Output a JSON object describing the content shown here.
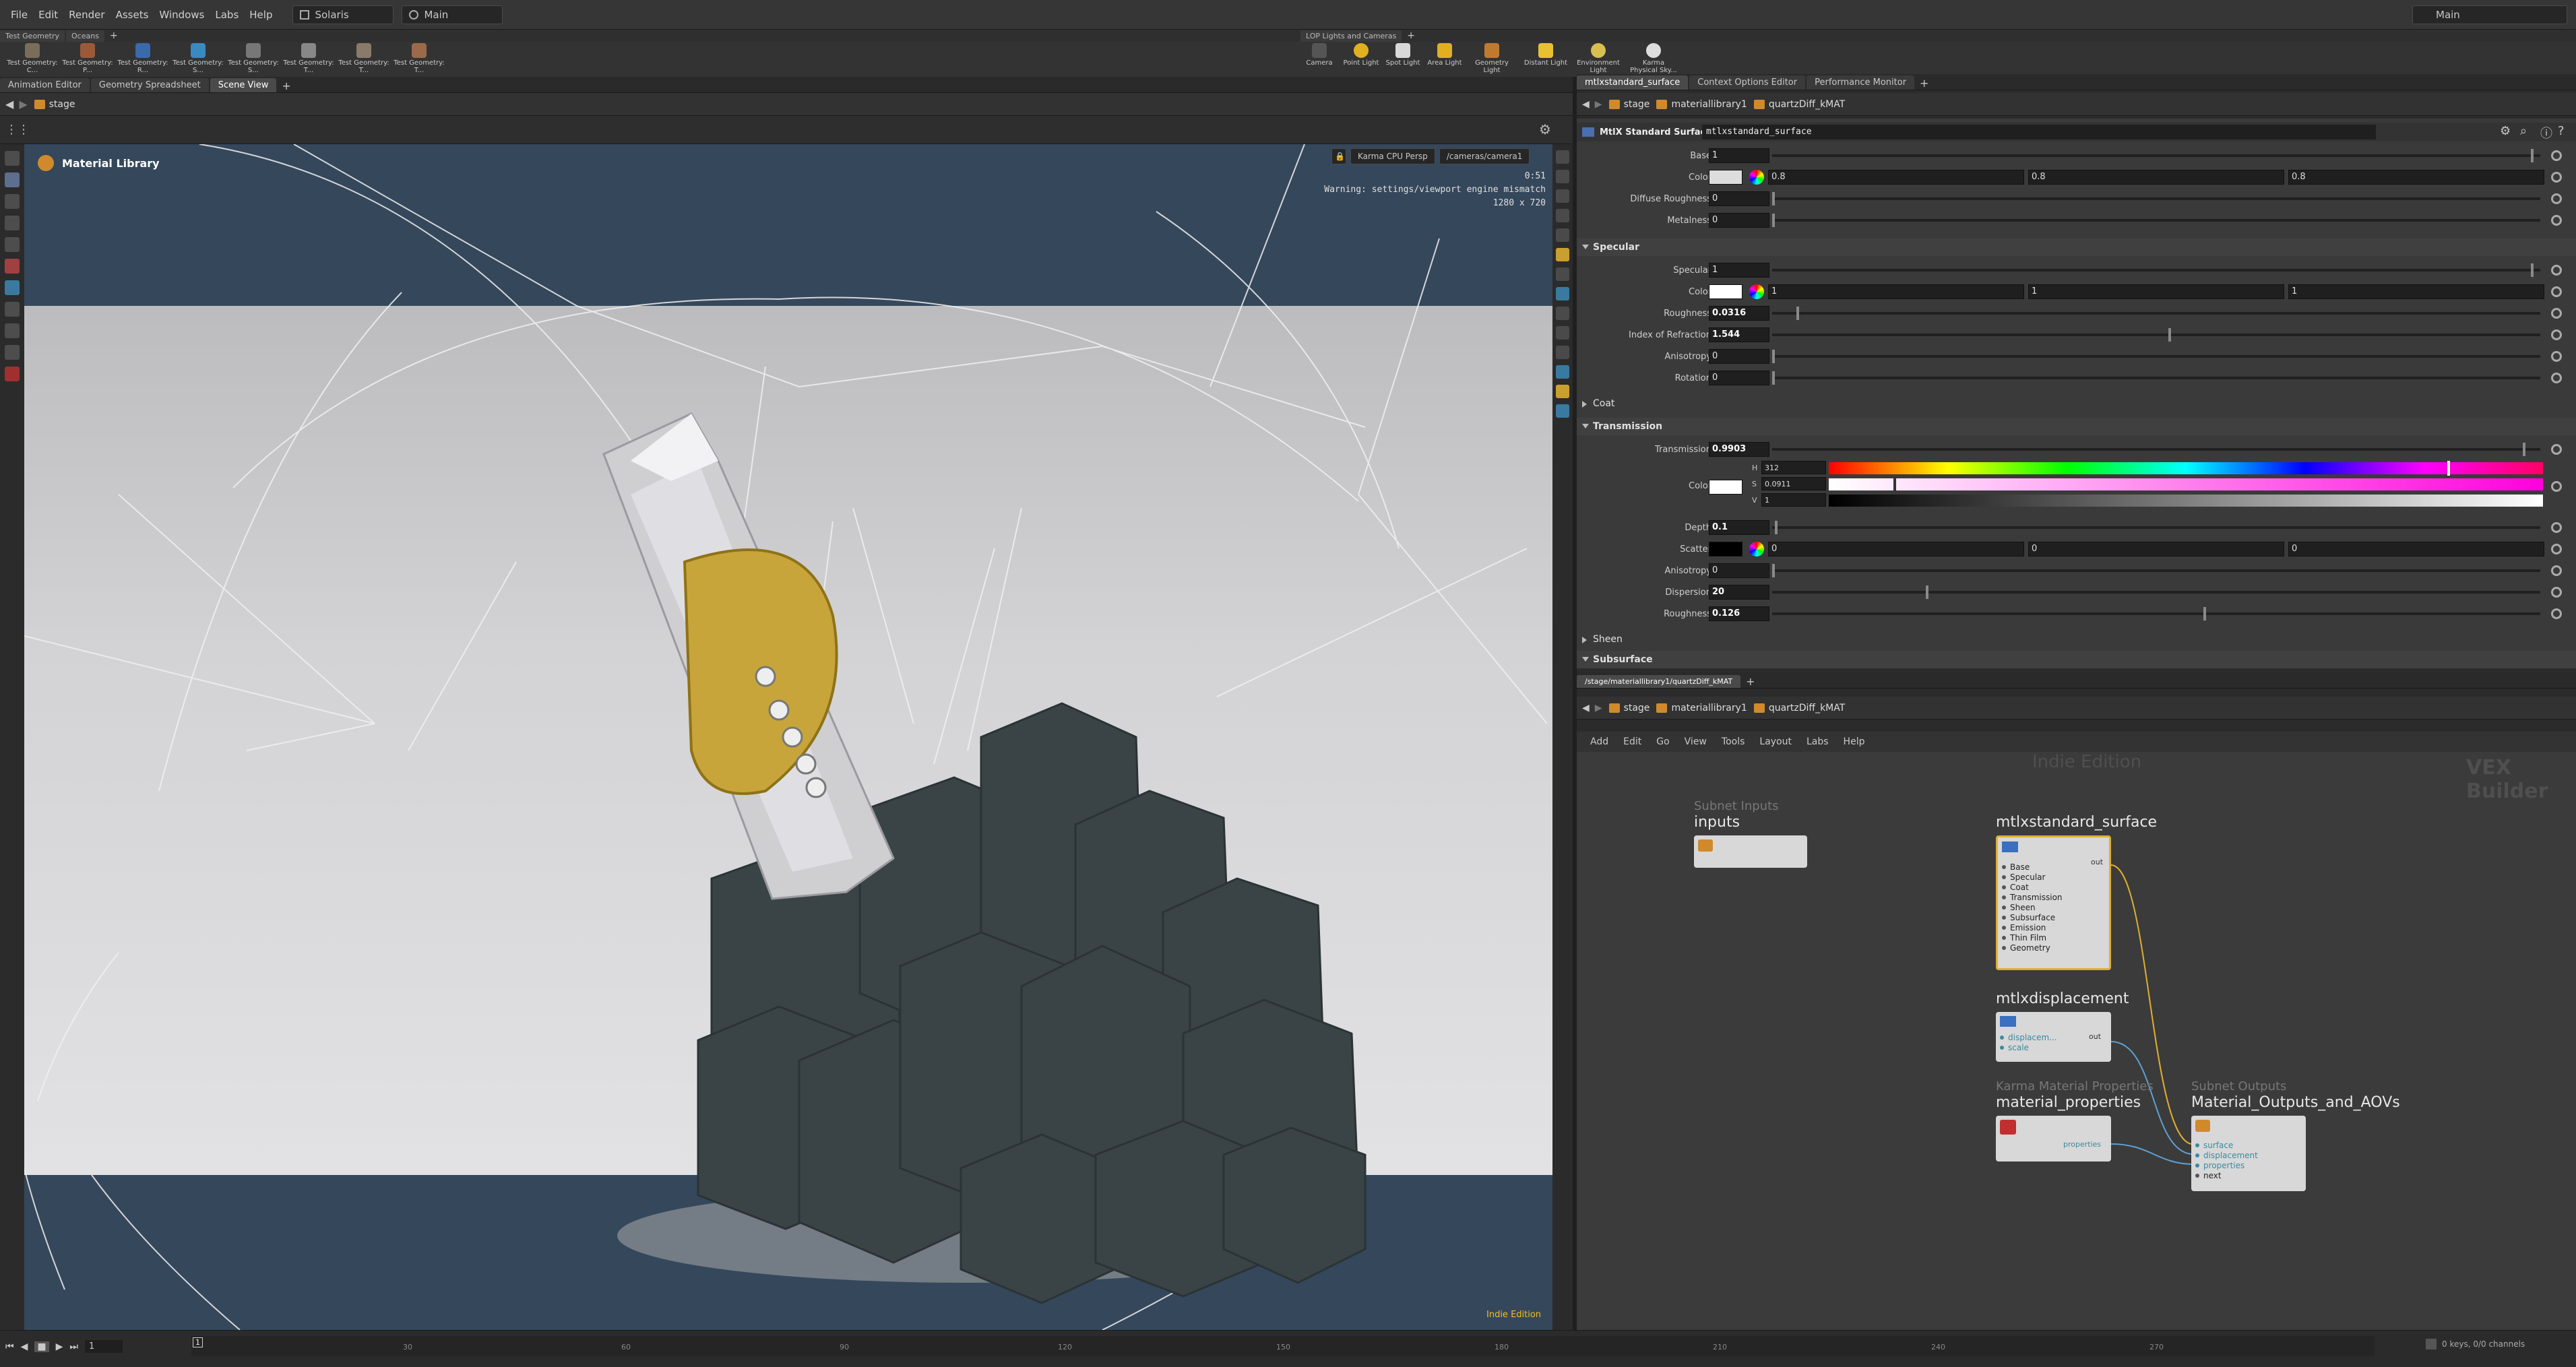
{
  "menubar": {
    "items": [
      "File",
      "Edit",
      "Render",
      "Assets",
      "Windows",
      "Labs",
      "Help"
    ],
    "desktop": "Solaris",
    "context": "Main",
    "right_context": "Main"
  },
  "shelf_left": {
    "tabs": [
      "Test Geometry",
      "Oceans"
    ],
    "tools": [
      "Test Geometry: C...",
      "Test Geometry: P...",
      "Test Geometry: R...",
      "Test Geometry: S...",
      "Test Geometry: S...",
      "Test Geometry: T...",
      "Test Geometry: T...",
      "Test Geometry: T..."
    ]
  },
  "shelf_right": {
    "tabs": [
      "LOP Lights and Cameras"
    ],
    "tools": [
      "Camera",
      "Point Light",
      "Spot Light",
      "Area Light",
      "Geometry Light",
      "Distant Light",
      "Environment Light",
      "Karma Physical Sky..."
    ]
  },
  "left_pane": {
    "tabs": [
      "Animation Editor",
      "Geometry Spreadsheet",
      "Scene View"
    ],
    "path": "stage"
  },
  "viewport": {
    "title": "Material Library",
    "renderer": "Karma CPU Persp",
    "camera": "/cameras/camera1",
    "time": "0:51",
    "warning": "Warning: settings/viewport engine mismatch",
    "resolution": "1280 x 720",
    "edition": "Indie Edition"
  },
  "param_pane": {
    "tabs": [
      "mtlxstandard_surface",
      "Context Options Editor",
      "Performance Monitor"
    ],
    "path": [
      "stage",
      "materiallibrary1",
      "quartzDiff_kMAT"
    ],
    "node_type": "MtlX Standard Surface",
    "node_name": "mtlxstandard_surface",
    "base": {
      "label": "Base",
      "value": "1"
    },
    "base_color": {
      "label": "Color",
      "r": "0.8",
      "g": "0.8",
      "b": "0.8"
    },
    "diffuse_roughness": {
      "label": "Diffuse Roughness",
      "value": "0"
    },
    "metalness": {
      "label": "Metalness",
      "value": "0"
    },
    "specular_section": "Specular",
    "specular": {
      "label": "Specular",
      "value": "1"
    },
    "specular_color": {
      "label": "Color",
      "r": "1",
      "g": "1",
      "b": "1"
    },
    "specular_roughness": {
      "label": "Roughness",
      "value": "0.0316"
    },
    "ior": {
      "label": "Index of Refraction",
      "value": "1.544"
    },
    "anisotropy": {
      "label": "Anisotropy",
      "value": "0"
    },
    "rotation": {
      "label": "Rotation",
      "value": "0"
    },
    "coat_section": "Coat",
    "transmission_section": "Transmission",
    "transmission": {
      "label": "Transmission",
      "value": "0.9903"
    },
    "trans_color": {
      "label": "Color",
      "h_label": "H",
      "h": "312",
      "s_label": "S",
      "s": "0.0911",
      "v_label": "V",
      "v": "1"
    },
    "depth": {
      "label": "Depth",
      "value": "0.1"
    },
    "scatter": {
      "label": "Scatter",
      "r": "0",
      "g": "0",
      "b": "0"
    },
    "trans_anisotropy": {
      "label": "Anisotropy",
      "value": "0"
    },
    "dispersion": {
      "label": "Dispersion",
      "value": "20"
    },
    "trans_roughness": {
      "label": "Roughness",
      "value": "0.126"
    },
    "sheen_section": "Sheen",
    "subsurface_section": "Subsurface"
  },
  "network_pane": {
    "tab": "/stage/materiallibrary1/quartzDiff_kMAT",
    "path": [
      "stage",
      "materiallibrary1",
      "quartzDiff_kMAT"
    ],
    "menu": [
      "Add",
      "Edit",
      "Go",
      "View",
      "Tools",
      "Layout",
      "Labs",
      "Help"
    ],
    "watermark_edition": "Indie Edition",
    "watermark_builder": "VEX Builder",
    "nodes": {
      "inputs": {
        "type": "Subnet Inputs",
        "name": "inputs"
      },
      "surface": {
        "name": "mtlxstandard_surface",
        "out": "out",
        "ports": [
          "Base",
          "Specular",
          "Coat",
          "Transmission",
          "Sheen",
          "Subsurface",
          "Emission",
          "Thin Film",
          "Geometry"
        ]
      },
      "displacement": {
        "name": "mtlxdisplacement",
        "out": "out",
        "ports": [
          "displacem...",
          "scale"
        ]
      },
      "properties": {
        "type": "Karma Material Properties",
        "name": "material_properties",
        "out": "properties"
      },
      "outputs": {
        "type": "Subnet Outputs",
        "name": "Material_Outputs_and_AOVs",
        "ports": [
          "surface",
          "displacement",
          "properties",
          "next"
        ]
      }
    }
  },
  "timeline": {
    "frame": "1",
    "start": "1",
    "ticks": [
      "30",
      "60",
      "90",
      "120",
      "150",
      "180",
      "210",
      "240",
      "270"
    ],
    "status": "0 keys, 0/0 channels"
  }
}
